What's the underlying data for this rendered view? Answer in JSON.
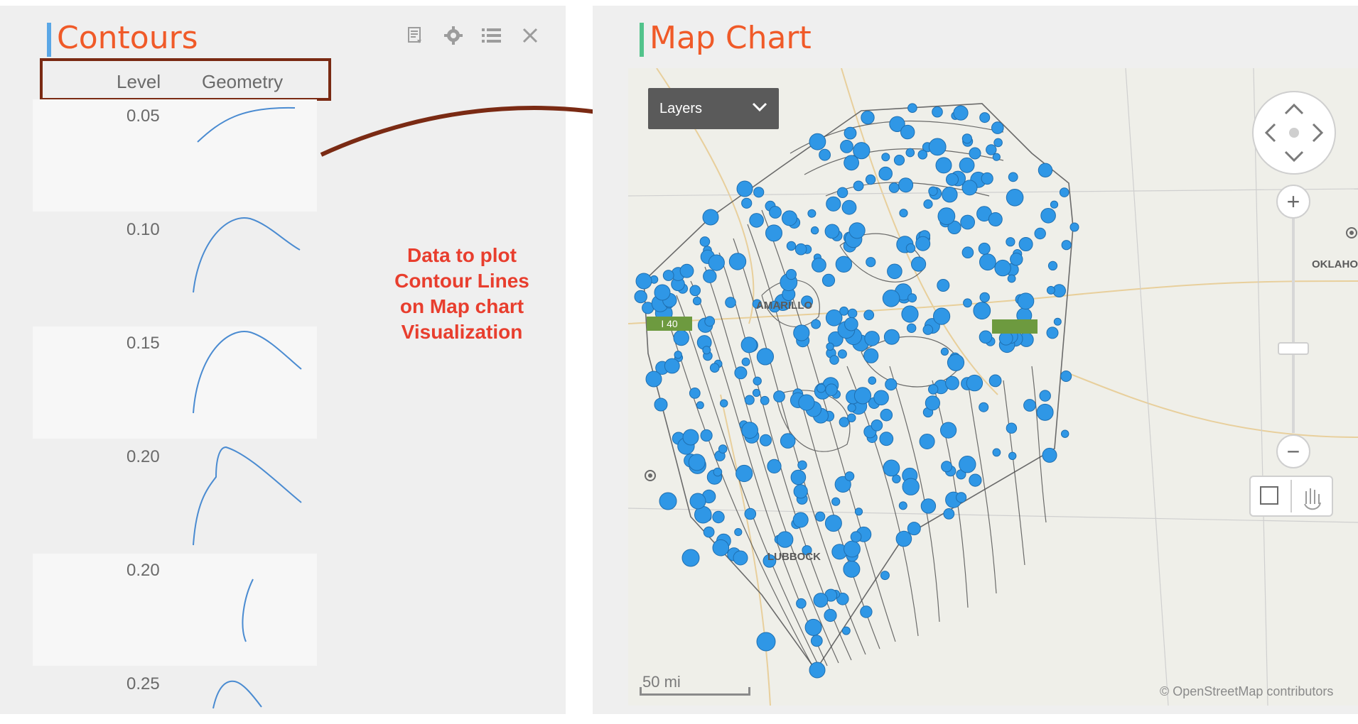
{
  "left_panel": {
    "title": "Contours",
    "headers": {
      "level": "Level",
      "geometry": "Geometry"
    },
    "rows": [
      {
        "level": "0.05"
      },
      {
        "level": "0.10"
      },
      {
        "level": "0.15"
      },
      {
        "level": "0.20"
      },
      {
        "level": "0.20"
      },
      {
        "level": "0.25"
      }
    ],
    "toolbar_icons": [
      "list-detail-icon",
      "gear-icon",
      "bullet-list-icon",
      "close-icon"
    ]
  },
  "annotation": {
    "lines": [
      "Data to plot",
      "Contour Lines",
      "on Map chart",
      "Visualization"
    ]
  },
  "right_panel": {
    "title": "Map Chart",
    "layers_label": "Layers",
    "cities": {
      "amarillo": "AMARILLO",
      "lubbock": "LUBBOCK",
      "oklahoma": "OKLAHO"
    },
    "highway": "I 40",
    "scale": "50 mi",
    "attribution": "© OpenStreetMap contributors"
  },
  "colors": {
    "accent_left": "#5aa7e6",
    "accent_right": "#52c38b",
    "title": "#f05a28",
    "arrow": "#7a2a13",
    "note": "#e83e2e",
    "marker": "#2f97e6"
  }
}
